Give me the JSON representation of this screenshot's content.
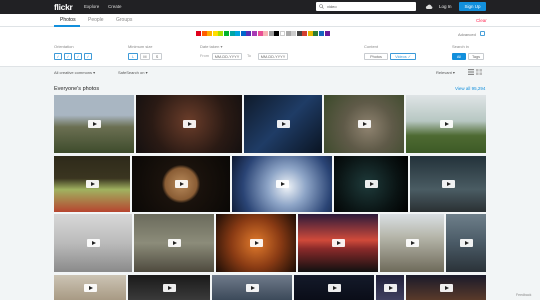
{
  "nav": {
    "logo": "flickr",
    "explore": "Explore",
    "create": "Create",
    "search_value": "video",
    "login": "Log In",
    "signup": "Sign Up"
  },
  "tabs": {
    "photos": "Photos",
    "people": "People",
    "groups": "Groups",
    "clear": "Clear"
  },
  "filters": {
    "advanced": "Advanced",
    "orientation_label": "Orientation",
    "min_size_label": "Minimum size",
    "sizes": [
      "L",
      "M",
      "S"
    ],
    "date_taken_label": "Date taken ▾",
    "from_label": "From",
    "from_placeholder": "MM-DD-YYYY",
    "to_label": "To",
    "to_placeholder": "MM-DD-YYYY",
    "content_label": "Content",
    "content_photos": "Photos",
    "content_videos": "Videos ✓",
    "search_in_label": "Search in",
    "search_all": "All",
    "search_tags": "Tags",
    "colors": [
      "#e0001b",
      "#ff5c00",
      "#ffad00",
      "#ffde00",
      "#a6e000",
      "#00b32d",
      "#00a6a6",
      "#00a5e0",
      "#0066cc",
      "#5a2fb5",
      "#a73ab5",
      "#e84e94",
      "#f5b5b5",
      "#9e9e9e",
      "#000000",
      "#ffffff",
      "#a8a8a8",
      "#cccccc",
      "#444444",
      "#d23f30",
      "#e6b800",
      "#2e7d32",
      "#1565c0",
      "#6a1b9a"
    ]
  },
  "toolbar": {
    "license": "All creative commons ▾",
    "safesearch": "SafeSearch on ▾",
    "sort": "Relevant ▾"
  },
  "results": {
    "heading": "Everyone's photos",
    "view_all": "View all 95,294"
  },
  "feedback": "Feedback"
}
